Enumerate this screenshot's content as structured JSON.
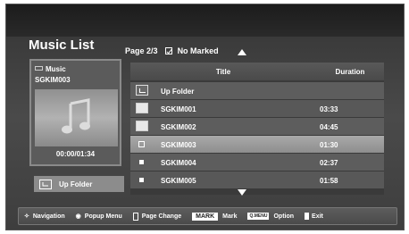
{
  "title": "Music List",
  "page_info": {
    "page": "Page 2/3",
    "marked": "No Marked"
  },
  "info_panel": {
    "category": "Music",
    "item_name": "SGKIM003",
    "time": "00:00/01:34"
  },
  "up_folder_button": "Up Folder",
  "list": {
    "columns": {
      "title": "Title",
      "duration": "Duration"
    },
    "rows": [
      {
        "title": "Up Folder",
        "duration": "",
        "icon": "up-folder-icon"
      },
      {
        "title": "SGKIM001",
        "duration": "03:33",
        "icon": "folder-icon"
      },
      {
        "title": "SGKIM002",
        "duration": "04:45",
        "icon": "folder-icon"
      },
      {
        "title": "SGKIM003",
        "duration": "01:30",
        "icon": "checkbox-icon",
        "selected": true
      },
      {
        "title": "SGKIM004",
        "duration": "02:37",
        "icon": "file-icon"
      },
      {
        "title": "SGKIM005",
        "duration": "01:58",
        "icon": "file-icon"
      }
    ]
  },
  "help_bar": {
    "navigation": "Navigation",
    "popup_menu": "Popup Menu",
    "page_change": "Page Change",
    "mark_key": "MARK",
    "mark": "Mark",
    "option_key": "Q.MENU",
    "option": "Option",
    "exit": "Exit"
  }
}
